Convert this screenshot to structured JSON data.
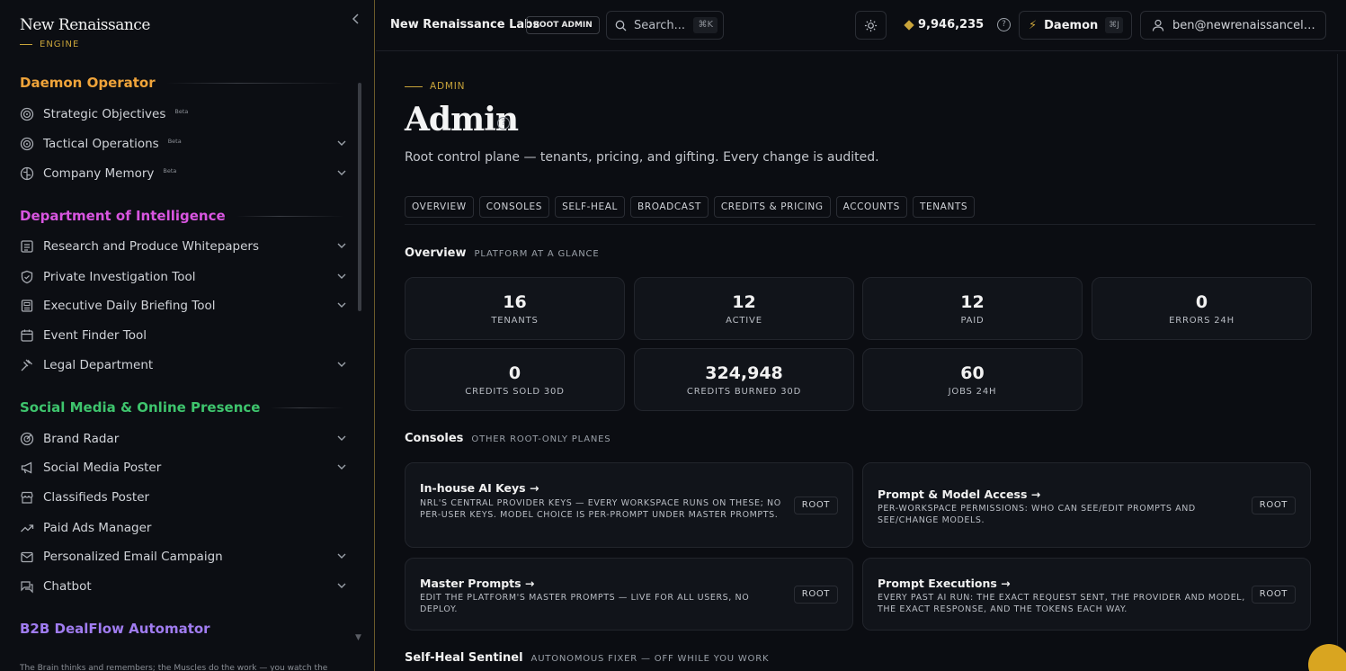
{
  "sidebar": {
    "brand": {
      "name": "New Renaissance",
      "sub": "ENGINE"
    },
    "sections": [
      {
        "title": "Daemon Operator",
        "color": "#f0a43a"
      },
      {
        "title": "Department of Intelligence",
        "color": "#d855e0"
      },
      {
        "title": "Social Media & Online Presence",
        "color": "#3ec46d"
      },
      {
        "title": "B2B DealFlow Automator",
        "color": "#a07cf0"
      }
    ],
    "items": [
      {
        "label": "Strategic Objectives",
        "badge": "Beta",
        "icon": "target-icon"
      },
      {
        "label": "Tactical Operations",
        "badge": "Beta",
        "icon": "target-icon",
        "expandable": true
      },
      {
        "label": "Company Memory",
        "badge": "Beta",
        "icon": "brain-icon",
        "expandable": true
      },
      {
        "label": "Research and Produce Whitepapers",
        "icon": "list-icon",
        "expandable": true
      },
      {
        "label": "Private Investigation Tool",
        "icon": "shield-icon",
        "expandable": true
      },
      {
        "label": "Executive Daily Briefing Tool",
        "icon": "newspaper-icon",
        "expandable": true
      },
      {
        "label": "Event Finder Tool",
        "icon": "calendar-icon"
      },
      {
        "label": "Legal Department",
        "icon": "gavel-icon",
        "expandable": true
      },
      {
        "label": "Brand Radar",
        "icon": "radar-icon",
        "expandable": true
      },
      {
        "label": "Social Media Poster",
        "icon": "megaphone-icon",
        "expandable": true
      },
      {
        "label": "Classifieds Poster",
        "icon": "store-icon"
      },
      {
        "label": "Paid Ads Manager",
        "icon": "trending-icon"
      },
      {
        "label": "Personalized Email Campaign",
        "icon": "mail-icon",
        "expandable": true
      },
      {
        "label": "Chatbot",
        "icon": "chat-icon",
        "expandable": true
      }
    ],
    "footer": "The Brain thinks and remembers; the Muscles do the work — you watch the"
  },
  "topbar": {
    "org": "New Renaissance Labs",
    "role_badge": "ROOT ADMIN",
    "search_placeholder": "Search...",
    "search_kbd": "⌘K",
    "credits": "9,946,235",
    "daemon_label": "Daemon",
    "daemon_kbd": "⌘J",
    "user_email": "ben@newrenaissancelabs.com"
  },
  "page": {
    "eyebrow": "ADMIN",
    "title": "Admin",
    "subtitle": "Root control plane — tenants, pricing, and gifting. Every change is audited.",
    "tabs": [
      "OVERVIEW",
      "CONSOLES",
      "SELF-HEAL",
      "BROADCAST",
      "CREDITS & PRICING",
      "ACCOUNTS",
      "TENANTS"
    ]
  },
  "overview": {
    "heading": "Overview",
    "sub": "PLATFORM AT A GLANCE",
    "stats": [
      {
        "value": "16",
        "label": "TENANTS"
      },
      {
        "value": "12",
        "label": "ACTIVE"
      },
      {
        "value": "12",
        "label": "PAID"
      },
      {
        "value": "0",
        "label": "ERRORS 24H"
      },
      {
        "value": "0",
        "label": "CREDITS SOLD 30D"
      },
      {
        "value": "324,948",
        "label": "CREDITS BURNED 30D"
      },
      {
        "value": "60",
        "label": "JOBS 24H"
      }
    ]
  },
  "consoles": {
    "heading": "Consoles",
    "sub": "OTHER ROOT-ONLY PLANES",
    "cards": [
      {
        "title": "In-house AI Keys →",
        "desc": "NRL'S CENTRAL PROVIDER KEYS — EVERY WORKSPACE RUNS ON THESE; NO PER-USER KEYS. MODEL CHOICE IS PER-PROMPT UNDER MASTER PROMPTS.",
        "badge": "ROOT"
      },
      {
        "title": "Prompt & Model Access →",
        "desc": "PER-WORKSPACE PERMISSIONS: WHO CAN SEE/EDIT PROMPTS AND SEE/CHANGE MODELS.",
        "badge": "ROOT"
      },
      {
        "title": "Master Prompts →",
        "desc": "EDIT THE PLATFORM'S MASTER PROMPTS — LIVE FOR ALL USERS, NO DEPLOY.",
        "badge": "ROOT"
      },
      {
        "title": "Prompt Executions →",
        "desc": "EVERY PAST AI RUN: THE EXACT REQUEST SENT, THE PROVIDER AND MODEL, THE EXACT RESPONSE, AND THE TOKENS EACH WAY.",
        "badge": "ROOT"
      }
    ]
  },
  "selfheal": {
    "heading": "Self-Heal Sentinel",
    "sub": "AUTONOMOUS FIXER — OFF WHILE YOU WORK"
  },
  "colors": {
    "accent": "#c9a43a",
    "background": "#0b0d12",
    "card": "#11141a",
    "fab": "#d9a520"
  }
}
